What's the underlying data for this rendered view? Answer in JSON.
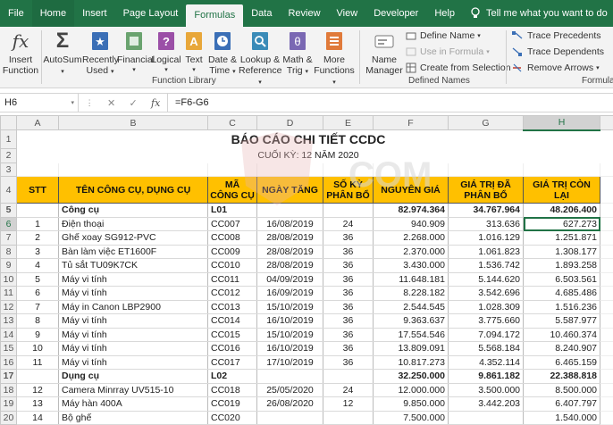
{
  "tabs": [
    "File",
    "Home",
    "Insert",
    "Page Layout",
    "Formulas",
    "Data",
    "Review",
    "View",
    "Developer",
    "Help"
  ],
  "active_tab": "Formulas",
  "tell_me": "Tell me what you want to do",
  "ribbon": {
    "insert_function": [
      "Insert",
      "Function"
    ],
    "autosum": [
      "AutoSum"
    ],
    "recently_used": [
      "Recently",
      "Used"
    ],
    "financial": [
      "Financial"
    ],
    "logical": [
      "Logical"
    ],
    "text": [
      "Text"
    ],
    "date_time": [
      "Date &",
      "Time"
    ],
    "lookup": [
      "Lookup &",
      "Reference"
    ],
    "math": [
      "Math &",
      "Trig"
    ],
    "more": [
      "More",
      "Functions"
    ],
    "group_function_library": "Function Library",
    "name_manager": [
      "Name",
      "Manager"
    ],
    "define_name": "Define Name",
    "use_in_formula": "Use in Formula",
    "create_from_selection": "Create from Selection",
    "group_defined_names": "Defined Names",
    "trace_precedents": "Trace Precedents",
    "trace_dependents": "Trace Dependents",
    "remove_arrows": "Remove Arrows",
    "group_formula_auditing": "Formula"
  },
  "name_box": "H6",
  "formula": "=F6-G6",
  "columns": [
    "A",
    "B",
    "C",
    "D",
    "E",
    "F",
    "G",
    "H"
  ],
  "title": "BÁO CÁO CHI TIẾT CCDC",
  "subtitle": "CUỐI KỲ: 12 NĂM 2020",
  "watermark": "COM",
  "headers": [
    "STT",
    "TÊN CÔNG CỤ, DỤNG CỤ",
    "MÃ CÔNG CỤ",
    "NGÀY TĂNG",
    "SỐ KỲ PHÂN BỔ",
    "NGUYÊN GIÁ",
    "GIÁ TRỊ ĐÃ PHÂN BỔ",
    "GIÁ TRỊ CÒN LẠI"
  ],
  "rows": [
    {
      "n": "5",
      "cells": [
        "",
        "Công cụ",
        "L01",
        "",
        "",
        "82.974.364",
        "34.767.964",
        "48.206.400"
      ],
      "group": true
    },
    {
      "n": "6",
      "cells": [
        "1",
        "Điện thoại",
        "CC007",
        "16/08/2019",
        "24",
        "940.909",
        "313.636",
        "627.273"
      ]
    },
    {
      "n": "7",
      "cells": [
        "2",
        "Ghế xoay SG912-PVC",
        "CC008",
        "28/08/2019",
        "36",
        "2.268.000",
        "1.016.129",
        "1.251.871"
      ]
    },
    {
      "n": "8",
      "cells": [
        "3",
        "Bàn làm việc ET1600F",
        "CC009",
        "28/08/2019",
        "36",
        "2.370.000",
        "1.061.823",
        "1.308.177"
      ]
    },
    {
      "n": "9",
      "cells": [
        "4",
        "Tủ sắt TU09K7CK",
        "CC010",
        "28/08/2019",
        "36",
        "3.430.000",
        "1.536.742",
        "1.893.258"
      ]
    },
    {
      "n": "10",
      "cells": [
        "5",
        "Máy vi tính",
        "CC011",
        "04/09/2019",
        "36",
        "11.648.181",
        "5.144.620",
        "6.503.561"
      ]
    },
    {
      "n": "11",
      "cells": [
        "6",
        "Máy vi tính",
        "CC012",
        "16/09/2019",
        "36",
        "8.228.182",
        "3.542.696",
        "4.685.486"
      ]
    },
    {
      "n": "12",
      "cells": [
        "7",
        "Máy in Canon LBP2900",
        "CC013",
        "15/10/2019",
        "36",
        "2.544.545",
        "1.028.309",
        "1.516.236"
      ]
    },
    {
      "n": "13",
      "cells": [
        "8",
        "Máy vi tính",
        "CC014",
        "16/10/2019",
        "36",
        "9.363.637",
        "3.775.660",
        "5.587.977"
      ]
    },
    {
      "n": "14",
      "cells": [
        "9",
        "Máy vi tính",
        "CC015",
        "15/10/2019",
        "36",
        "17.554.546",
        "7.094.172",
        "10.460.374"
      ]
    },
    {
      "n": "15",
      "cells": [
        "10",
        "Máy vi tính",
        "CC016",
        "16/10/2019",
        "36",
        "13.809.091",
        "5.568.184",
        "8.240.907"
      ]
    },
    {
      "n": "16",
      "cells": [
        "11",
        "Máy vi tính",
        "CC017",
        "17/10/2019",
        "36",
        "10.817.273",
        "4.352.114",
        "6.465.159"
      ]
    },
    {
      "n": "17",
      "cells": [
        "",
        "Dụng cụ",
        "L02",
        "",
        "",
        "32.250.000",
        "9.861.182",
        "22.388.818"
      ],
      "group": true
    },
    {
      "n": "18",
      "cells": [
        "12",
        "Camera Minrray UV515-10",
        "CC018",
        "25/05/2020",
        "24",
        "12.000.000",
        "3.500.000",
        "8.500.000"
      ]
    },
    {
      "n": "19",
      "cells": [
        "13",
        "Máy hàn 400A",
        "CC019",
        "26/08/2020",
        "12",
        "9.850.000",
        "3.442.203",
        "6.407.797"
      ]
    },
    {
      "n": "20",
      "cells": [
        "14",
        "Bộ ghế",
        "CC020",
        "",
        "",
        "7.500.000",
        "",
        "1.540.000"
      ]
    }
  ]
}
